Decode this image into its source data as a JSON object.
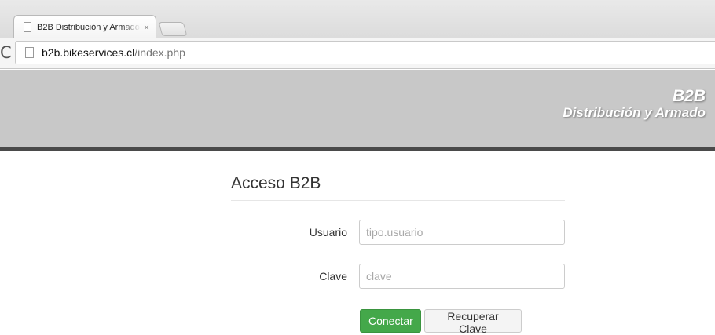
{
  "browser": {
    "tab_title": "B2B Distribución y Armado",
    "tab_close": "×",
    "reload_glyph": "C",
    "url_host": "b2b.bikeservices.cl",
    "url_path": "/index.php"
  },
  "header": {
    "brand_title": "B2B",
    "brand_subtitle": "Distribución y Armado"
  },
  "login": {
    "title": "Acceso B2B",
    "user_label": "Usuario",
    "user_placeholder": "tipo.usuario",
    "user_value": "",
    "password_label": "Clave",
    "password_placeholder": "clave",
    "password_value": "",
    "connect_label": "Conectar",
    "recover_label": "Recuperar Clave"
  },
  "colors": {
    "primary_button": "#44a84a",
    "header_band": "#c8c8c8",
    "header_rule": "#4a4a4a"
  }
}
